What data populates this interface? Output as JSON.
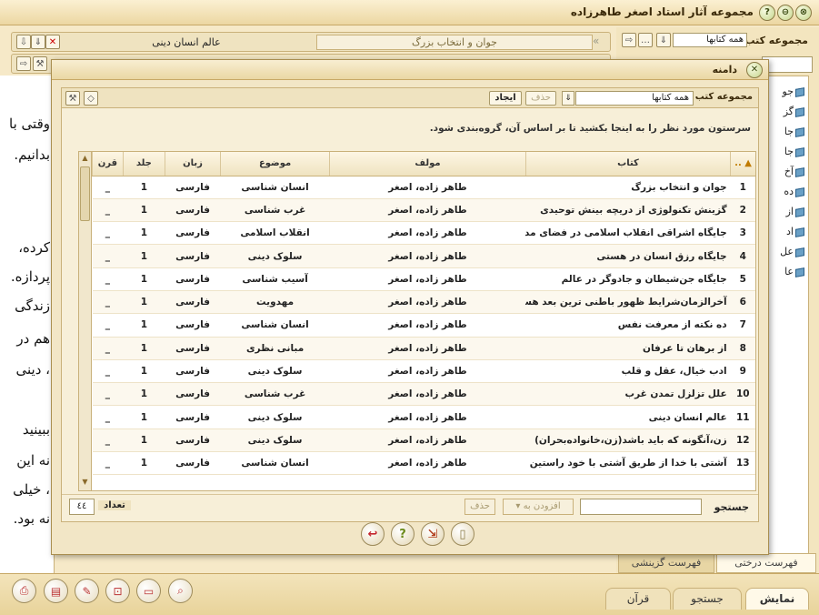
{
  "app": {
    "title": "مجموعه آثار استاد اصغر طاهرزاده",
    "window_buttons": [
      "⊗",
      "⊖",
      "?"
    ]
  },
  "reader": {
    "active_tab": "جوان و انتخاب بزرگ",
    "current_title": "عالم انسان دینی",
    "page_fragments": [
      "وقتی با",
      "بدانیم.",
      "کرده،",
      "پردازه.",
      "زندگی",
      "هم در",
      "، دینی",
      "ببینید",
      "نه این",
      "، خیلی",
      "نه بود."
    ]
  },
  "side_panel": {
    "title": "مجموعه کتب",
    "combo_value": "همه کتابها",
    "items": [
      "جو",
      "گز",
      "جا",
      "جا",
      "آخ",
      "ده",
      "از",
      "اد",
      "عل",
      "عا"
    ],
    "tabs": [
      "فهرست درختی",
      "فهرست گزينشی"
    ]
  },
  "bottom": {
    "tabs": [
      "نمایش",
      "جستجو",
      "قرآن"
    ]
  },
  "dialog": {
    "title": "دامنه",
    "collection_label": "مجموعه کتب",
    "collection_value": "همه کتابها",
    "create_label": "ایجاد",
    "delete_label": "حذف",
    "hint": "سرستون مورد نظر را به اینجا بکشید تا بر اساس آن، گروه‌بندی شود.",
    "columns": {
      "sort": "▲ ..",
      "book": "کتاب",
      "author": "مولف",
      "topic": "موضوع",
      "lang": "زبان",
      "vol": "جلد",
      "quran": "قرن"
    },
    "rows": [
      {
        "n": "1",
        "book": "جوان و انتخاب بزرگ",
        "author": "طاهر زاده، اصغر",
        "topic": "انسان شناسی",
        "lang": "فارسی",
        "vol": "1",
        "quran": "_"
      },
      {
        "n": "2",
        "book": "گزینش تکنولوژی از دریچه بینش توحیدی",
        "author": "طاهر زاده، اصغر",
        "topic": "غرب شناسی",
        "lang": "فارسی",
        "vol": "1",
        "quran": "_"
      },
      {
        "n": "3",
        "book": "جایگاه اشراقی انقلاب اسلامی در فضای مدرنیسم",
        "author": "طاهر زاده، اصغر",
        "topic": "انقلاب اسلامی",
        "lang": "فارسی",
        "vol": "1",
        "quran": "_"
      },
      {
        "n": "4",
        "book": "جایگاه رزق انسان در هستی",
        "author": "طاهر زاده، اصغر",
        "topic": "سلوک دینی",
        "lang": "فارسی",
        "vol": "1",
        "quran": "_"
      },
      {
        "n": "5",
        "book": "جایگاه جن‌شیطان و جادوگر در عالم",
        "author": "طاهر زاده، اصغر",
        "topic": "آسیب شناسی",
        "lang": "فارسی",
        "vol": "1",
        "quran": "_"
      },
      {
        "n": "6",
        "book": "آخرالزمان‌شرایط ظهور باطنی ترین بعد هستی",
        "author": "طاهر زاده، اصغر",
        "topic": "مهدویت",
        "lang": "فارسی",
        "vol": "1",
        "quran": "_"
      },
      {
        "n": "7",
        "book": "ده نکته از معرفت نفس",
        "author": "طاهر زاده، اصغر",
        "topic": "انسان شناسی",
        "lang": "فارسی",
        "vol": "1",
        "quran": "_"
      },
      {
        "n": "8",
        "book": "از برهان تا عرفان",
        "author": "طاهر زاده، اصغر",
        "topic": "مبانی نظری",
        "lang": "فارسی",
        "vol": "1",
        "quran": "_"
      },
      {
        "n": "9",
        "book": "ادب خیال، عقل و قلب",
        "author": "طاهر زاده، اصغر",
        "topic": "سلوک دینی",
        "lang": "فارسی",
        "vol": "1",
        "quran": "_"
      },
      {
        "n": "10",
        "book": "علل تزلزل تمدن غرب",
        "author": "طاهر زاده، اصغر",
        "topic": "غرب شناسی",
        "lang": "فارسی",
        "vol": "1",
        "quran": "_"
      },
      {
        "n": "11",
        "book": "عالم انسان دینی",
        "author": "طاهر زاده، اصغر",
        "topic": "سلوک دینی",
        "lang": "فارسی",
        "vol": "1",
        "quran": "_"
      },
      {
        "n": "12",
        "book": "زن،آنگونه که باید باشد(زن،خانواده‌بحران)",
        "author": "طاهر زاده، اصغر",
        "topic": "سلوک دینی",
        "lang": "فارسی",
        "vol": "1",
        "quran": "_"
      },
      {
        "n": "13",
        "book": "آشتی با خدا از طریق آشتی با خود راستین",
        "author": "طاهر زاده، اصغر",
        "topic": "انسان شناسی",
        "lang": "فارسی",
        "vol": "1",
        "quran": "_"
      }
    ],
    "search_label": "جستجو",
    "add_to_label": "افزودن به ▾",
    "footer_delete_label": "حذف",
    "count_label": "تعداد",
    "count_value": "٤٤"
  }
}
